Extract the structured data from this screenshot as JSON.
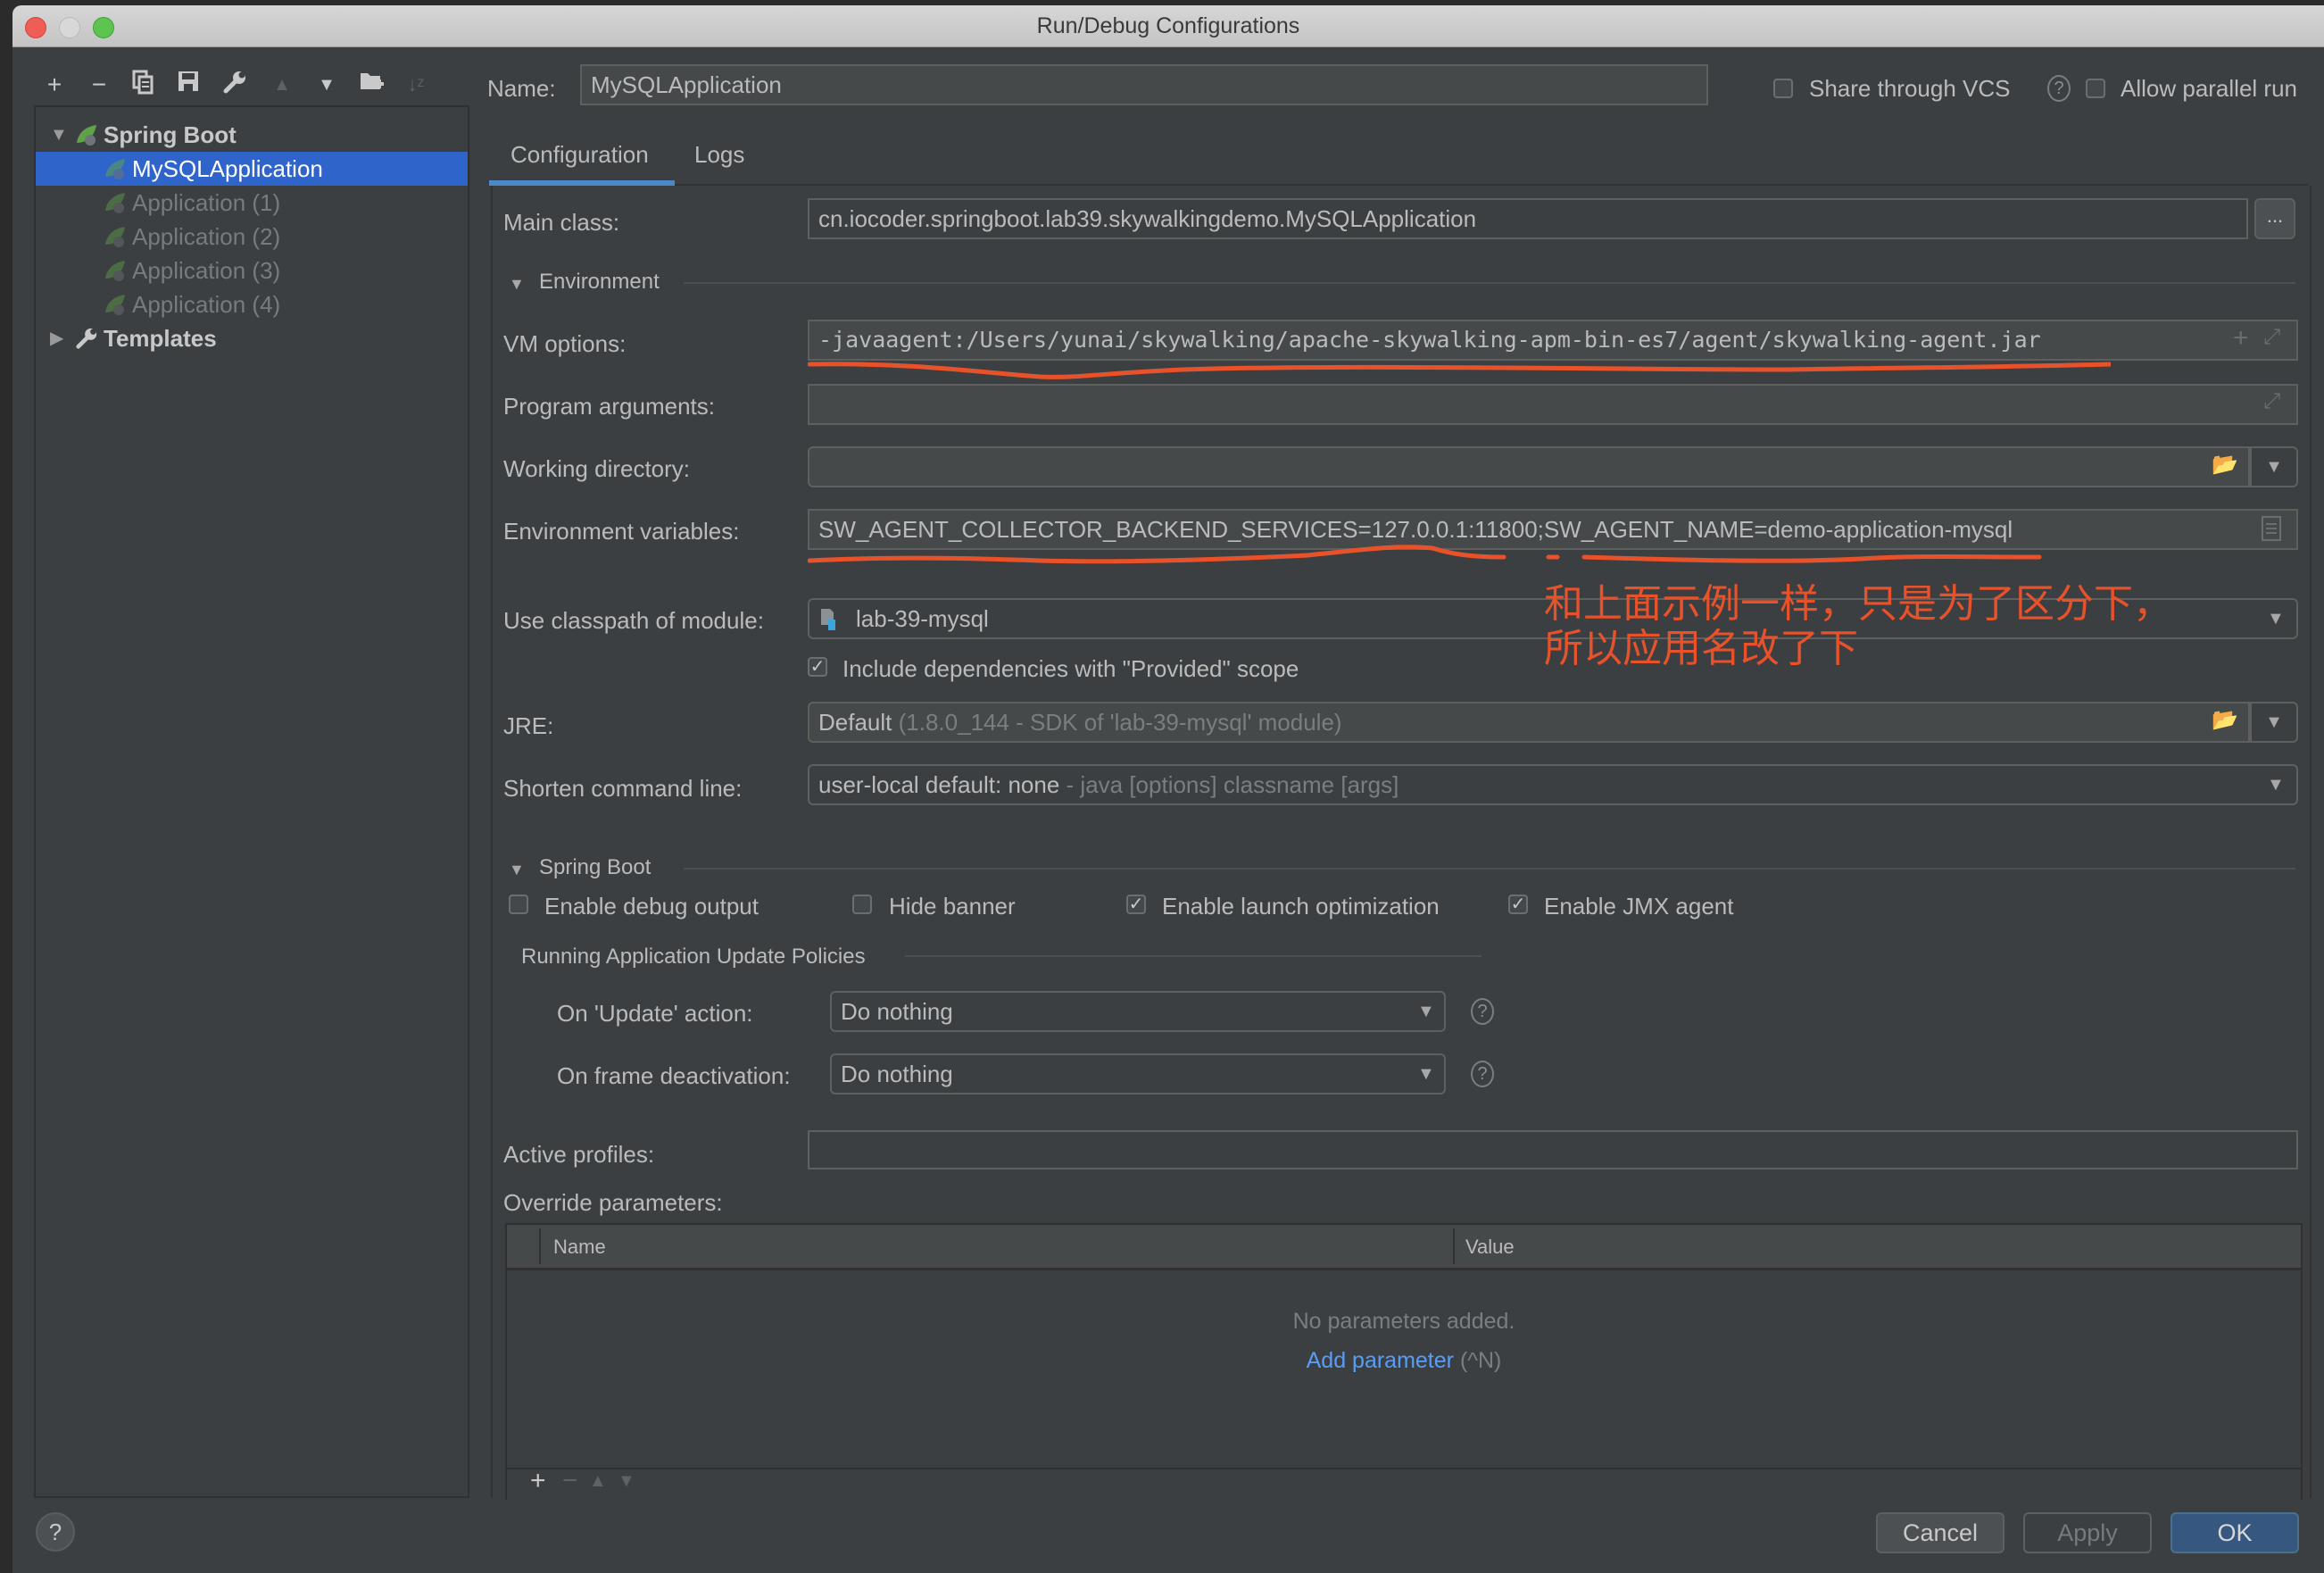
{
  "window": {
    "title": "Run/Debug Configurations"
  },
  "toolbar": {
    "icons": [
      "plus-icon",
      "minus-icon",
      "copy-icon",
      "save-icon",
      "wrench-icon",
      "arrow-up-icon",
      "arrow-down-icon",
      "new-folder-icon",
      "sort-alpha-icon"
    ]
  },
  "tree": {
    "root_label": "Spring Boot",
    "items": [
      {
        "label": "MySQLApplication",
        "selected": true
      },
      {
        "label": "Application (1)",
        "selected": false
      },
      {
        "label": "Application (2)",
        "selected": false
      },
      {
        "label": "Application (3)",
        "selected": false
      },
      {
        "label": "Application (4)",
        "selected": false
      }
    ],
    "templates_label": "Templates"
  },
  "header": {
    "name_label": "Name:",
    "name_value": "MySQLApplication",
    "share_vcs_label": "Share through VCS",
    "share_vcs_checked": false,
    "allow_parallel_label": "Allow parallel run",
    "allow_parallel_checked": false
  },
  "tabs": [
    {
      "label": "Configuration",
      "active": true
    },
    {
      "label": "Logs",
      "active": false
    }
  ],
  "config": {
    "main_class_label": "Main class:",
    "main_class_value": "cn.iocoder.springboot.lab39.skywalkingdemo.MySQLApplication",
    "browse_button": "...",
    "environment_section": "Environment",
    "vm_options_label": "VM options:",
    "vm_options_value": "-javaagent:/Users/yunai/skywalking/apache-skywalking-apm-bin-es7/agent/skywalking-agent.jar",
    "program_args_label": "Program arguments:",
    "program_args_value": "",
    "working_dir_label": "Working directory:",
    "working_dir_value": "",
    "env_vars_label": "Environment variables:",
    "env_vars_value": "SW_AGENT_COLLECTOR_BACKEND_SERVICES=127.0.0.1:11800;SW_AGENT_NAME=demo-application-mysql",
    "classpath_label": "Use classpath of module:",
    "classpath_value": "lab-39-mysql",
    "include_provided_label": "Include dependencies with \"Provided\" scope",
    "include_provided_checked": true,
    "jre_label": "JRE:",
    "jre_value": "Default",
    "jre_hint": "(1.8.0_144 - SDK of 'lab-39-mysql' module)",
    "shorten_label": "Shorten command line:",
    "shorten_value": "user-local default: none",
    "shorten_hint": "- java [options] classname [args]"
  },
  "spring_boot": {
    "section": "Spring Boot",
    "enable_debug_label": "Enable debug output",
    "enable_debug_checked": false,
    "hide_banner_label": "Hide banner",
    "hide_banner_checked": false,
    "launch_opt_label": "Enable launch optimization",
    "launch_opt_checked": true,
    "jmx_label": "Enable JMX agent",
    "jmx_checked": true,
    "policies_section": "Running Application Update Policies",
    "on_update_label": "On 'Update' action:",
    "on_update_value": "Do nothing",
    "on_frame_label": "On frame deactivation:",
    "on_frame_value": "Do nothing",
    "active_profiles_label": "Active profiles:",
    "active_profiles_value": "",
    "override_label": "Override parameters:",
    "table_columns": [
      "Name",
      "Value"
    ],
    "empty_text": "No parameters added.",
    "add_param_link": "Add parameter",
    "add_param_shortcut": "(^N)"
  },
  "annotation": {
    "line1": "和上面示例一样，只是为了区分下，",
    "line2": "所以应用名改了下",
    "color": "#e8522a"
  },
  "footer": {
    "help": "?",
    "cancel": "Cancel",
    "apply": "Apply",
    "ok": "OK"
  }
}
